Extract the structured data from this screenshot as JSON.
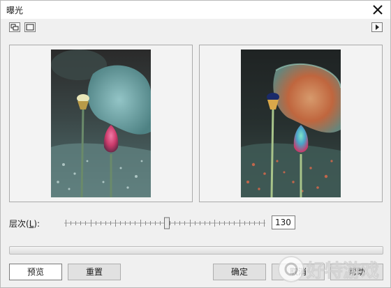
{
  "window": {
    "title": "曝光"
  },
  "controls": {
    "level_label_prefix": "层次(",
    "level_label_key": "L",
    "level_label_suffix": "):",
    "level_value": "130",
    "slider_fraction": 0.51
  },
  "buttons": {
    "preview": "预览",
    "reset": "重置",
    "ok": "确定",
    "cancel": "取消",
    "help": "帮助"
  },
  "watermark": {
    "text": "好特游戏"
  },
  "colors": {
    "dialog_bg": "#f0f0f0",
    "accent_teal": "#7fb6b9",
    "bud_pink": "#c93a6a",
    "leaf_orange": "#c8693f"
  }
}
